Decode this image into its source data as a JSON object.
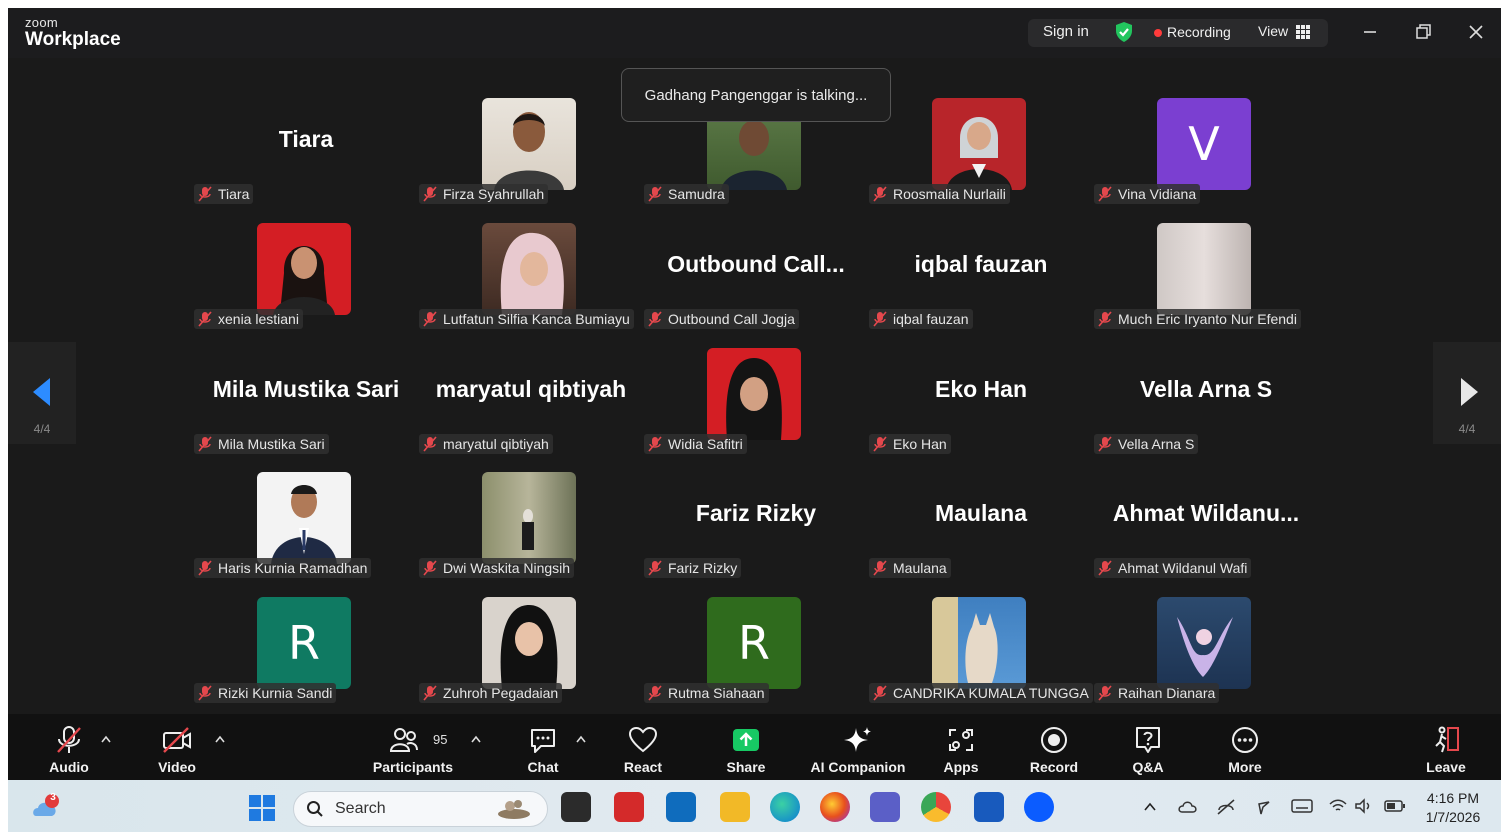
{
  "window": {
    "logo_small": "zoom",
    "logo_big": "Workplace",
    "sign_in": "Sign in",
    "recording": "Recording",
    "view": "View"
  },
  "stage": {
    "talking_toast": "Gadhang Pangenggar is talking...",
    "page_indicator": "4/4",
    "tiles": [
      {
        "name": "Tiara",
        "big": "Tiara"
      },
      {
        "name": "Firza Syahrullah"
      },
      {
        "name": "Samudra"
      },
      {
        "name": "Roosmalia Nurlaili"
      },
      {
        "name": "Vina Vidiana",
        "letter": "V"
      },
      {
        "name": "xenia lestiani"
      },
      {
        "name": "Lutfatun Silfia Kanca Bumiayu"
      },
      {
        "name": "Outbound Call Jogja",
        "big": "Outbound  Call..."
      },
      {
        "name": "iqbal fauzan",
        "big": "iqbal fauzan"
      },
      {
        "name": "Much Eric Iryanto Nur Efendi"
      },
      {
        "name": "Mila Mustika Sari",
        "big": "Mila Mustika Sari"
      },
      {
        "name": "maryatul qibtiyah",
        "big": "maryatul qibtiyah"
      },
      {
        "name": "Widia Safitri"
      },
      {
        "name": "Eko Han",
        "big": "Eko Han"
      },
      {
        "name": "Vella Arna S",
        "big": "Vella Arna S"
      },
      {
        "name": "Haris Kurnia Ramadhan"
      },
      {
        "name": "Dwi Waskita Ningsih"
      },
      {
        "name": "Fariz Rizky",
        "big": "Fariz Rizky"
      },
      {
        "name": "Maulana",
        "big": "Maulana"
      },
      {
        "name": "Ahmat Wildanul Wafi",
        "big": "Ahmat  Wildanu..."
      },
      {
        "name": "Rizki Kurnia Sandi",
        "letter": "R"
      },
      {
        "name": "Zuhroh Pegadaian"
      },
      {
        "name": "Rutma Siahaan",
        "letter": "R"
      },
      {
        "name": "CANDRIKA KUMALA TUNGGA"
      },
      {
        "name": "Raihan Dianara"
      }
    ]
  },
  "toolbar": {
    "audio": "Audio",
    "video": "Video",
    "participants": "Participants",
    "participant_count": "95",
    "chat": "Chat",
    "react": "React",
    "share": "Share",
    "ai_companion": "AI Companion",
    "apps": "Apps",
    "record": "Record",
    "qa": "Q&A",
    "more": "More",
    "leave": "Leave"
  },
  "taskbar": {
    "search": "Search",
    "weather_badge": "3",
    "time": "4:16 PM",
    "date": "1/7/2026"
  },
  "colors": {
    "stage_bg": "#1a1a1a",
    "muted_red": "#e5484d",
    "share_green": "#17c964",
    "letter_v": "#7b3fd1",
    "letter_r1": "#0f7a62",
    "letter_r2": "#2f6b1d"
  }
}
